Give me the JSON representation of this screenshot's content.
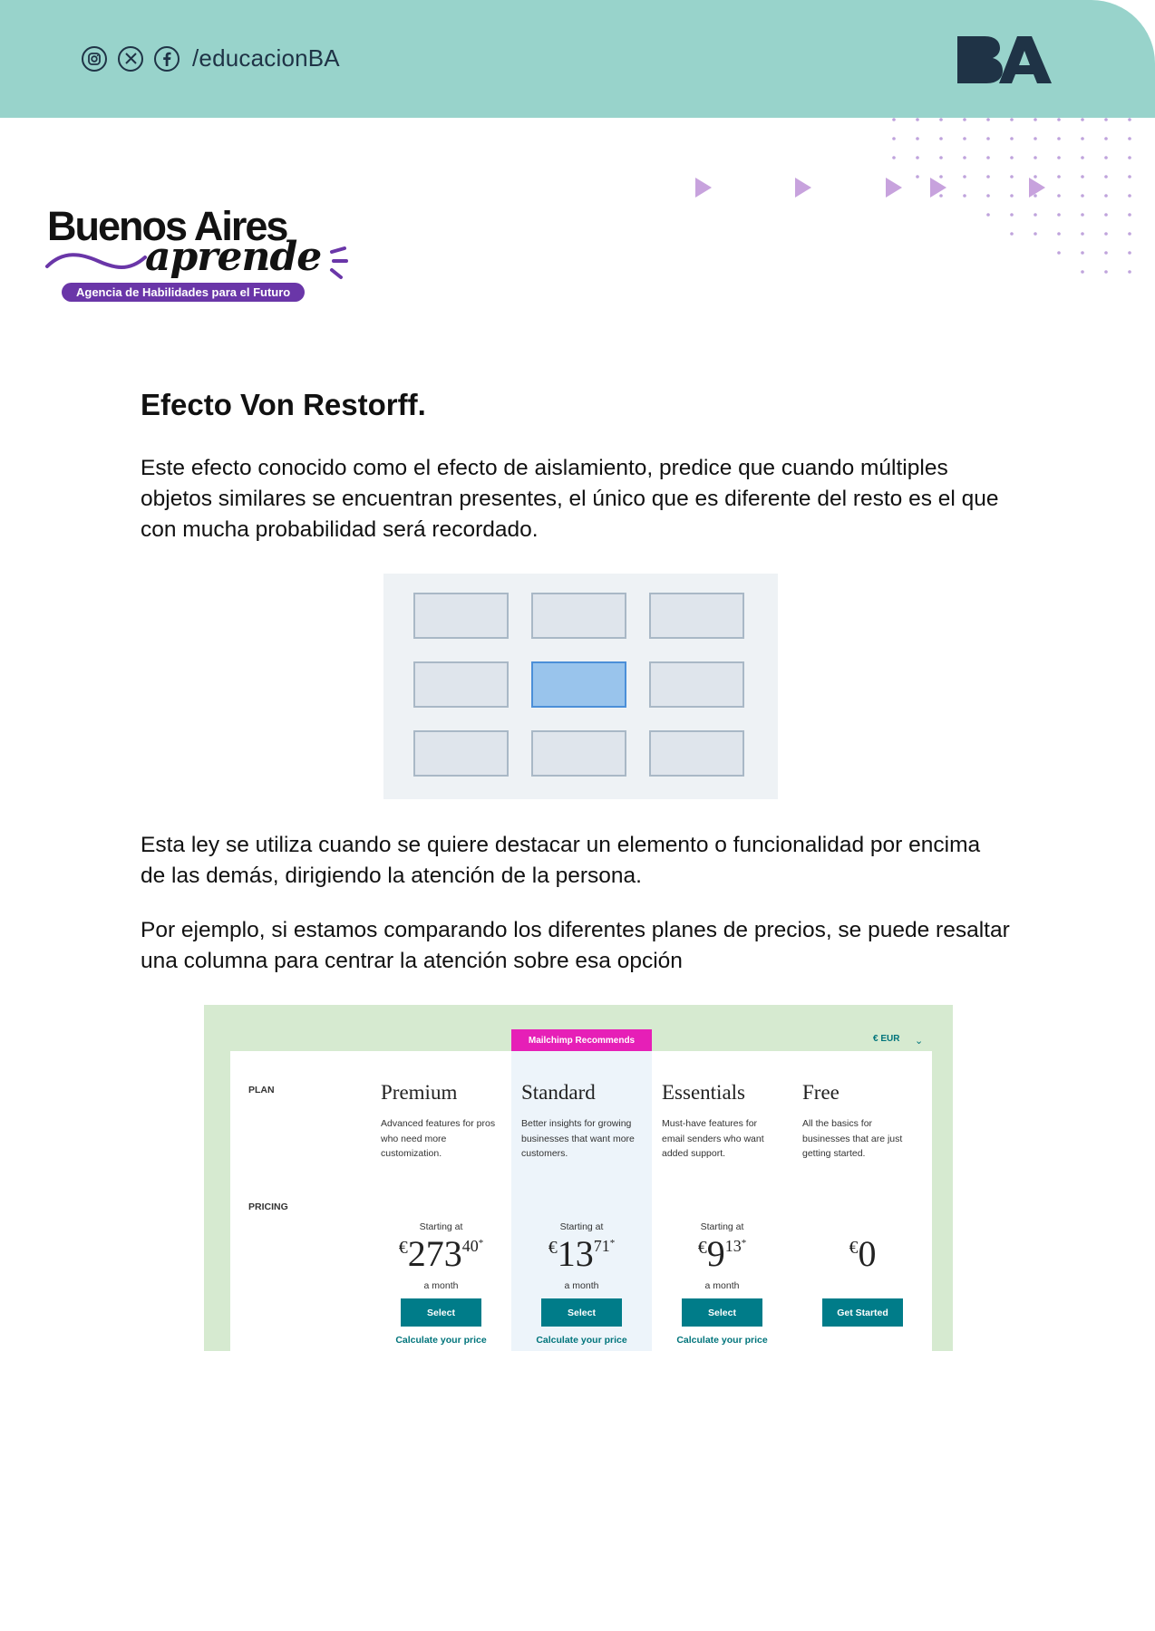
{
  "header": {
    "social_handle": "/educacionBA",
    "social_icons": [
      "instagram-icon",
      "x-icon",
      "facebook-icon"
    ],
    "brand_logo_text": "BA",
    "background_color": "#98d3cb"
  },
  "logo": {
    "line1": "Buenos Aires",
    "line2": "aprende",
    "tagline": "Agencia de Habilidades para el Futuro",
    "accent_color": "#6a36a8"
  },
  "content": {
    "title": "Efecto Von Restorff.",
    "paragraph1": "Este efecto conocido como el efecto de aislamiento, predice que cuando múltiples objetos similares se encuentran presentes, el único que es diferente del resto es el que con mucha probabilidad será recordado.",
    "paragraph2": "Esta ley se utiliza cuando se quiere destacar un elemento o funcionalidad por encima de las demás, dirigiendo la atención de la persona.",
    "paragraph3": "Por ejemplo, si estamos comparando los diferentes planes de precios, se puede resaltar una columna para centrar la atención sobre esa opción"
  },
  "illustration": {
    "rows": 3,
    "cols": 3,
    "highlighted_row": 1,
    "highlighted_col": 1,
    "cell_color": "#dfe5ec",
    "highlight_color": "#99c4ec"
  },
  "pricing": {
    "recommendation": "Mailchimp Recommends",
    "currency": "€ EUR",
    "row_labels": {
      "plan": "PLAN",
      "pricing": "PRICING"
    },
    "plans": [
      {
        "name": "Premium",
        "description": "Advanced features for pros who need more customization.",
        "starting": "Starting at",
        "currency_symbol": "€",
        "price_main": "273",
        "price_cents": "40",
        "asterisk": "*",
        "period": "a month",
        "button": "Select",
        "calc": "Calculate your price"
      },
      {
        "name": "Standard",
        "description": "Better insights for growing businesses that want more customers.",
        "starting": "Starting at",
        "currency_symbol": "€",
        "price_main": "13",
        "price_cents": "71",
        "asterisk": "*",
        "period": "a month",
        "button": "Select",
        "calc": "Calculate your price"
      },
      {
        "name": "Essentials",
        "description": "Must-have features for email senders who want added support.",
        "starting": "Starting at",
        "currency_symbol": "€",
        "price_main": "9",
        "price_cents": "13",
        "asterisk": "*",
        "period": "a month",
        "button": "Select",
        "calc": "Calculate your price"
      },
      {
        "name": "Free",
        "description": "All the basics for businesses that are just getting started.",
        "starting": "",
        "currency_symbol": "€",
        "price_main": "0",
        "price_cents": "",
        "asterisk": "",
        "period": "",
        "button": "Get Started",
        "calc": ""
      }
    ],
    "colors": {
      "frame": "#d6ead0",
      "highlight_column": "#edf4fa",
      "recommend_badge": "#e61fb7",
      "button": "#007c89"
    }
  }
}
